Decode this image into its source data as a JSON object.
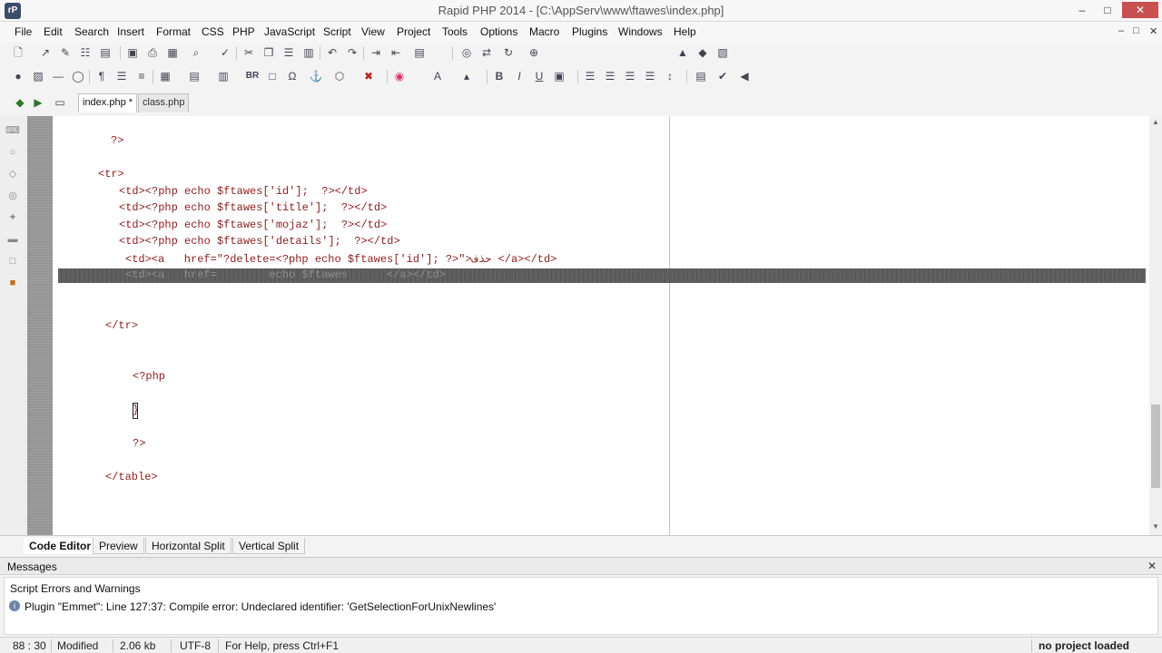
{
  "window": {
    "title": "Rapid PHP 2014 - [C:\\AppServ\\www\\ftawes\\index.php]",
    "logo": "rP",
    "minimize": "–",
    "maximize": "□",
    "close": "✕"
  },
  "menu": {
    "items": [
      "File",
      "Edit",
      "Search",
      "Insert",
      "Format",
      "CSS",
      "PHP",
      "JavaScript",
      "Script",
      "View",
      "Project",
      "Tools",
      "Options",
      "Macro",
      "Plugins",
      "Windows",
      "Help"
    ],
    "mdi": [
      "–",
      "□",
      "✕"
    ]
  },
  "toolbar1": {
    "icons": [
      "new-file-icon",
      "open-file-icon",
      "edit-icon",
      "save-icon",
      "open-folder-icon",
      "save-all-icon",
      "print-icon",
      "print-preview-icon",
      "find-icon",
      "spellcheck-icon",
      "cut-icon",
      "copy-icon",
      "paste-icon",
      "paste-special-icon",
      "undo-icon",
      "redo-icon",
      "indent-icon",
      "outdent-icon",
      "window-layout-icon",
      "binoculars-icon",
      "replace-icon",
      "sync-icon",
      "zoom-icon",
      "zoom-out-icon",
      "tag-icon"
    ]
  },
  "toolbar2": {
    "icons": [
      "globe-icon",
      "image-icon",
      "hr-icon",
      "comment-icon",
      "paragraph-icon",
      "list-icon",
      "ordered-list-icon",
      "table-icon",
      "form-icon",
      "element-icon",
      "br-icon",
      "nbsp-icon",
      "omega-icon",
      "link-icon",
      "shape-icon",
      "color-picker-icon",
      "color-wheel-icon",
      "font-icon",
      "font-size-icon",
      "bold-icon",
      "italic-icon",
      "underline-icon",
      "style-icon",
      "align-left-icon",
      "align-center-icon",
      "align-right-icon",
      "justify-icon",
      "line-height-icon",
      "preview-icon",
      "validate-icon",
      "back-icon"
    ],
    "br_label": "BR",
    "bold_label": "B",
    "italic_label": "I",
    "underline_label": "U",
    "font_label": "A"
  },
  "tabs": [
    {
      "label": "index.php *",
      "active": true
    },
    {
      "label": "class.php",
      "active": false
    }
  ],
  "code": {
    "lines": [
      "?>",
      "<tr>",
      "<td><?php echo $ftawes['id'];  ?></td>",
      "<td><?php echo $ftawes['title'];  ?></td>",
      "<td><?php echo $ftawes['mojaz'];  ?></td>",
      "<td><?php echo $ftawes['details'];  ?></td>",
      "<td><a   href=\"?delete=<?php echo $ftawes['id']; ?>\">حذف </a></td>",
      "</tr>",
      "<?php",
      "}",
      "?>",
      "</table>"
    ],
    "highlighted_line": "<td><a   href=        echo $ftawes      </a></td>"
  },
  "view_tabs": [
    "Code Editor",
    "Preview",
    "Horizontal Split",
    "Vertical Split"
  ],
  "messages": {
    "title": "Messages",
    "group": "Script Errors and Warnings",
    "entries": [
      "Plugin \"Emmet\": Line 127:37:  Compile error: Undeclared identifier: 'GetSelectionForUnixNewlines'"
    ]
  },
  "status": {
    "position": "88 : 30",
    "state": "Modified",
    "size": "2.06 kb",
    "encoding": "UTF-8",
    "help": "For Help, press Ctrl+F1",
    "project": "no project loaded"
  }
}
